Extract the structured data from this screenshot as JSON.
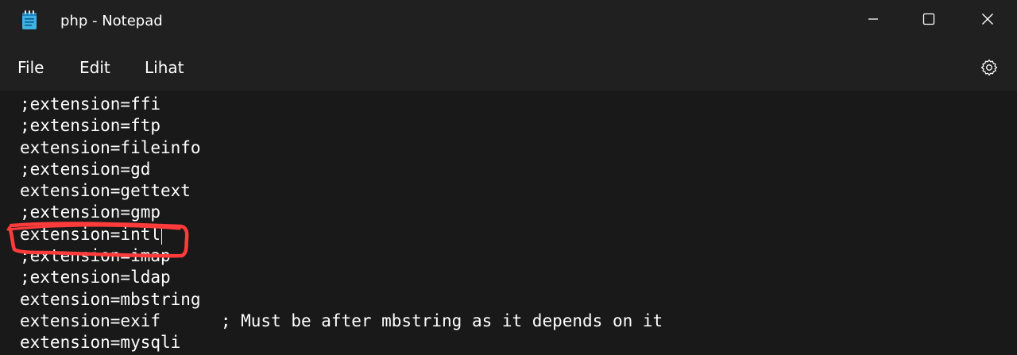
{
  "window": {
    "title": "php - Notepad",
    "app_icon": "notepad-icon",
    "controls": [
      "minimize-icon",
      "maximize-icon",
      "close-icon"
    ]
  },
  "menu": {
    "items": [
      "File",
      "Edit",
      "Lihat"
    ],
    "settings_icon": "gear-icon"
  },
  "editor": {
    "lines": [
      ";extension=ffi",
      ";extension=ftp",
      "extension=fileinfo",
      ";extension=gd",
      "extension=gettext",
      ";extension=gmp",
      "extension=intl",
      ";extension=imap",
      ";extension=ldap",
      "extension=mbstring",
      "extension=exif      ; Must be after mbstring as it depends on it",
      "extension=mysqli"
    ],
    "highlighted_line": "extension=intl"
  },
  "colors": {
    "background": "#191919",
    "chrome": "#202020",
    "text": "#ffffff",
    "annotation": "#ff3b3b"
  }
}
